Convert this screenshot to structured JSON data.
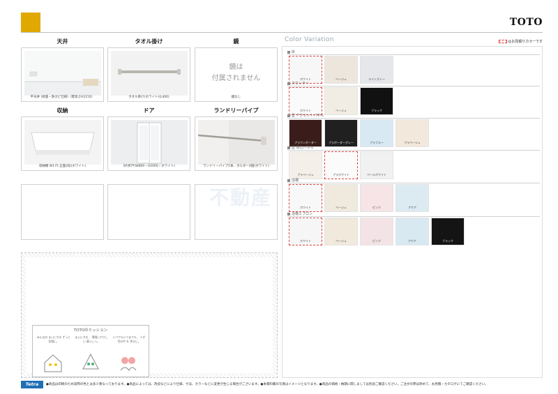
{
  "brand": "TOTO",
  "accent": "#e0a800",
  "items": [
    {
      "title": "天井",
      "caption": "平天井 (抗菌・防カビ仕様)（壁高さH2150）"
    },
    {
      "title": "タオル掛け",
      "caption": "タオル掛け(ホワイト)(L400)"
    },
    {
      "title": "鏡",
      "caption": "鏡なし",
      "mirror_text_1": "鏡は",
      "mirror_text_2": "付属されません"
    },
    {
      "title": "収納",
      "caption": "収納棚 W175 正面2段(ホワイト)"
    },
    {
      "title": "ドア",
      "caption": "3片折戸(W800・H2000・ホワイト)"
    },
    {
      "title": "ランドリーパイプ",
      "caption": "ランドリーパイプ1本、ホルダー4個(ホワイト)"
    }
  ],
  "mission": {
    "title": "TOTOのミッション",
    "col1": "みんなの まいにちを ずっと笑顔に。",
    "col2": "まいにちを、 環境にやさしい 暮らしへ。",
    "col3": "いつでもいつまでも、 人が世の中 を 幸せに。"
  },
  "color_variation": {
    "title": "Color Variation",
    "note": "はお見積りカラーです",
    "sections": [
      {
        "label": "床",
        "swatches": [
          {
            "name": "ホワイト",
            "color": "#f7f7f7",
            "selected": true
          },
          {
            "name": "ベージュ",
            "color": "#ede6dc",
            "selected": false
          },
          {
            "name": "ライトグレー",
            "color": "#e6e7ea",
            "selected": false
          }
        ]
      },
      {
        "label": "カウンター",
        "swatches": [
          {
            "name": "ホワイト",
            "color": "#fafafa",
            "selected": true
          },
          {
            "name": "ベージュ",
            "color": "#f2ede4",
            "selected": false
          },
          {
            "name": "ブラック",
            "color": "#111111",
            "selected": false
          }
        ]
      },
      {
        "label": "壁 アクセントパネル",
        "swatches": [
          {
            "name": "プラウンボーダー",
            "color": "#3a1c1a",
            "selected": false
          },
          {
            "name": "プラボーダーグレー",
            "color": "#202020",
            "selected": false
          },
          {
            "name": "プラブルー",
            "color": "#d8e9f4",
            "selected": false
          },
          {
            "name": "プラベージュ",
            "color": "#f3e8dc",
            "selected": false
          }
        ]
      },
      {
        "label": "壁 周辺パネル",
        "swatches": [
          {
            "name": "プラベージュ",
            "color": "#f4efe8",
            "selected": false
          },
          {
            "name": "プラホワイト",
            "color": "#fbfbfb",
            "selected": true
          },
          {
            "name": "ペールホワイト",
            "color": "#f1f1f1",
            "selected": false
          }
        ]
      },
      {
        "label": "浴槽",
        "swatches": [
          {
            "name": "ホワイト",
            "color": "#f8f8f8",
            "selected": true
          },
          {
            "name": "ベージュ",
            "color": "#efe9de",
            "selected": false
          },
          {
            "name": "ピンク",
            "color": "#f6e4e6",
            "selected": false
          },
          {
            "name": "アクア",
            "color": "#dcebf2",
            "selected": false
          }
        ]
      },
      {
        "label": "浴槽エプロン",
        "swatches": [
          {
            "name": "ホワイト",
            "color": "#f6f6f6",
            "selected": true
          },
          {
            "name": "ベージュ",
            "color": "#f0e9dc",
            "selected": false
          },
          {
            "name": "ピンク",
            "color": "#f4e3e6",
            "selected": false
          },
          {
            "name": "アクア",
            "color": "#d9e9f2",
            "selected": false
          },
          {
            "name": "ブラック",
            "color": "#141414",
            "selected": false
          }
        ]
      }
    ]
  },
  "footer": {
    "logo": "Tetra",
    "text": "●商品は印刷のため実際の色とは多少異なっております。●商品によっては、改良などにより仕様、寸法、カラーなどに変更が生じる場合がございます。●本資料載の写真はイメージとなります。●商品の価格・納期に関しましては別途ご確認ください。ご注文の際は改めて、お見積・カタログにてご確認ください。"
  }
}
